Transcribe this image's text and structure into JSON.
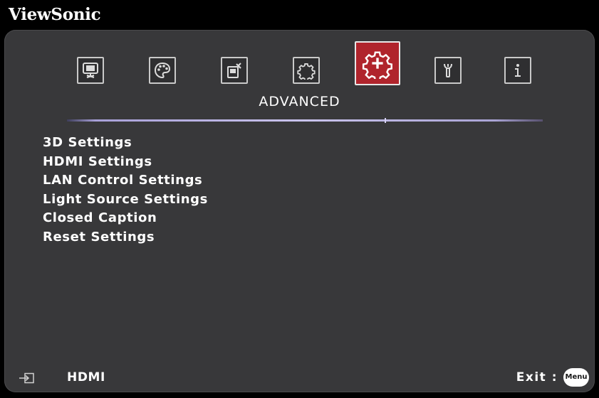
{
  "brand": "ViewSonic",
  "tabs": [
    {
      "icon": "presentation-screen-icon",
      "active": false
    },
    {
      "icon": "palette-icon",
      "active": false
    },
    {
      "icon": "phone-settings-icon",
      "active": false
    },
    {
      "icon": "gear-icon",
      "active": false
    },
    {
      "icon": "advanced-gear-plus-icon",
      "active": true
    },
    {
      "icon": "wrench-icon",
      "active": false
    },
    {
      "icon": "info-icon",
      "active": false
    }
  ],
  "section_title": "ADVANCED",
  "menu_items": [
    "3D Settings",
    "HDMI Settings",
    "LAN Control Settings",
    "Light Source Settings",
    "Closed Caption",
    "Reset Settings"
  ],
  "footer": {
    "source_icon": "input-source-icon",
    "source": "HDMI",
    "exit_label": "Exit :",
    "menu_button": "Menu"
  },
  "colors": {
    "background": "#000000",
    "panel": "#38383a",
    "active_tab": "#b0242c",
    "divider": "#c9c3ec",
    "text": "#ffffff"
  }
}
